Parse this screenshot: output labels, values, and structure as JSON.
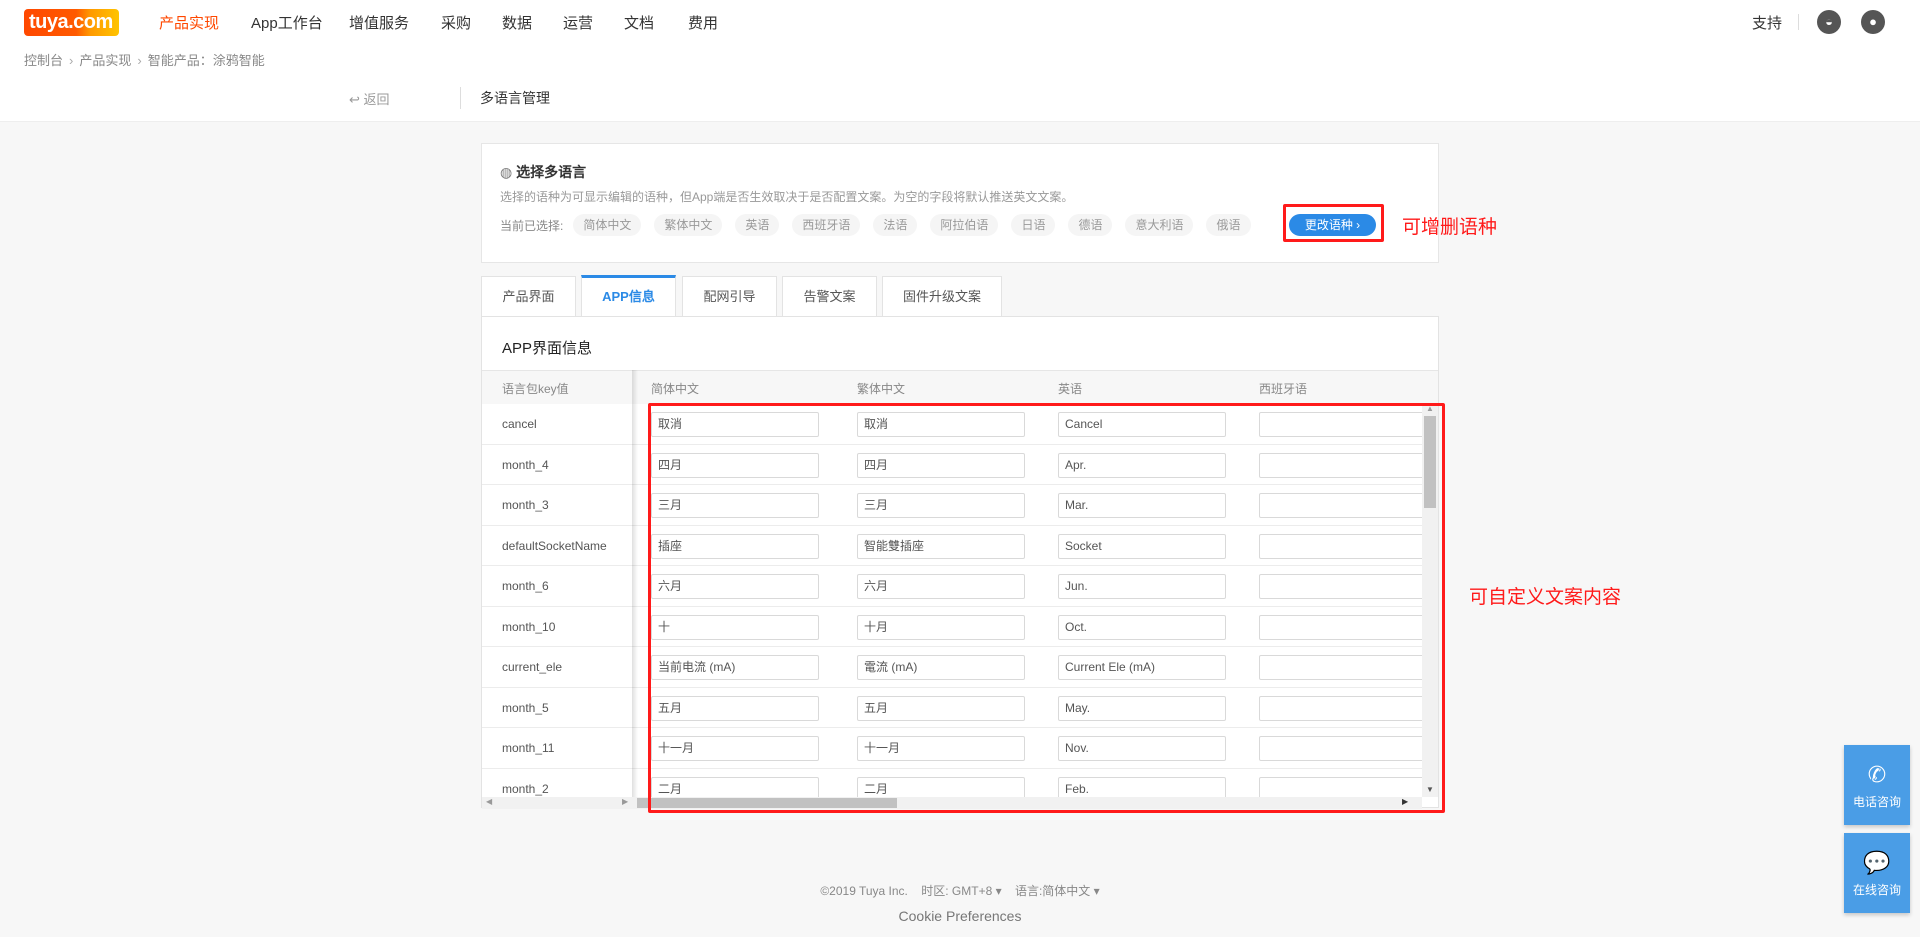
{
  "header": {
    "logo": "tuya.com",
    "nav": [
      {
        "label": "产品实现",
        "active": true
      },
      {
        "label": "App工作台"
      },
      {
        "label": "增值服务"
      },
      {
        "label": "采购"
      },
      {
        "label": "数据"
      },
      {
        "label": "运营"
      },
      {
        "label": "文档"
      },
      {
        "label": "费用"
      }
    ],
    "support": "支持",
    "icons": [
      "planet-icon",
      "user-avatar-icon"
    ]
  },
  "breadcrumb": [
    "控制台",
    "产品实现",
    "智能产品：涂鸦智能"
  ],
  "subbar": {
    "back": "返回",
    "title": "多语言管理"
  },
  "language_card": {
    "title": "选择多语言",
    "description": "选择的语种为可显示编辑的语种，但App端是否生效取决于是否配置文案。为空的字段将默认推送英文文案。",
    "selected_label": "当前已选择:",
    "languages": [
      "简体中文",
      "繁体中文",
      "英语",
      "西班牙语",
      "法语",
      "阿拉伯语",
      "日语",
      "德语",
      "意大利语",
      "俄语"
    ],
    "change_button": "更改语种"
  },
  "annotations": {
    "change_note": "可增删语种",
    "content_note": "可自定义文案内容",
    "color": "#ff1a1a"
  },
  "tabs": [
    {
      "label": "产品界面"
    },
    {
      "label": "APP信息",
      "active": true
    },
    {
      "label": "配网引导"
    },
    {
      "label": "告警文案"
    },
    {
      "label": "固件升级文案"
    }
  ],
  "panel": {
    "title": "APP界面信息",
    "columns": [
      "语言包key值",
      "简体中文",
      "繁体中文",
      "英语",
      "西班牙语"
    ],
    "rows": [
      {
        "key": "cancel",
        "values": [
          "取消",
          "取消",
          "Cancel",
          ""
        ]
      },
      {
        "key": "month_4",
        "values": [
          "四月",
          "四月",
          "Apr.",
          ""
        ]
      },
      {
        "key": "month_3",
        "values": [
          "三月",
          "三月",
          "Mar.",
          ""
        ]
      },
      {
        "key": "defaultSocketName",
        "values": [
          "插座",
          "智能雙插座",
          "Socket",
          ""
        ]
      },
      {
        "key": "month_6",
        "values": [
          "六月",
          "六月",
          "Jun.",
          ""
        ]
      },
      {
        "key": "month_10",
        "values": [
          "十",
          "十月",
          "Oct.",
          ""
        ]
      },
      {
        "key": "current_ele",
        "values": [
          "当前电流 (mA)",
          "電流 (mA)",
          "Current Ele (mA)",
          ""
        ]
      },
      {
        "key": "month_5",
        "values": [
          "五月",
          "五月",
          "May.",
          ""
        ]
      },
      {
        "key": "month_11",
        "values": [
          "十一月",
          "十一月",
          "Nov.",
          ""
        ]
      },
      {
        "key": "month_2",
        "values": [
          "二月",
          "二月",
          "Feb.",
          ""
        ]
      }
    ]
  },
  "footer": {
    "copyright": "©2019 Tuya Inc.",
    "timezone": "时区: GMT+8",
    "language": "语言:简体中文",
    "cookie": "Cookie Preferences"
  },
  "float_buttons": [
    {
      "label": "电话咨询",
      "icon": "phone-icon"
    },
    {
      "label": "在线咨询",
      "icon": "chat-icon"
    }
  ],
  "colors": {
    "brand": "#ff4800",
    "accent": "#2b8ae6",
    "float": "#4a9de6"
  }
}
